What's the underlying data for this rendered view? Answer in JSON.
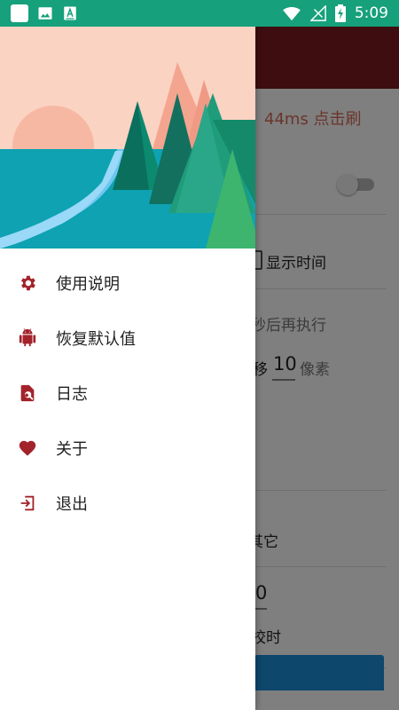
{
  "status_bar": {
    "time": "5:09",
    "battery_level": "charging"
  },
  "background_screen": {
    "speed_text": "44ms  点击刷",
    "show_time_label": "显示时间",
    "delay_label": "秒后再执行",
    "offset_prefix": "移",
    "offset_value": "10",
    "offset_unit": "像素",
    "other_label": "其它",
    "field_value": "0",
    "calibrate_label": "校时"
  },
  "drawer": {
    "menu": [
      {
        "label": "使用说明",
        "icon": "gear-icon"
      },
      {
        "label": "恢复默认值",
        "icon": "android-icon"
      },
      {
        "label": "日志",
        "icon": "log-search-icon"
      },
      {
        "label": "关于",
        "icon": "heart-icon"
      },
      {
        "label": "退出",
        "icon": "exit-icon"
      }
    ]
  },
  "colors": {
    "status_bar": "#16a07b",
    "accent": "#a3232b",
    "toolbar": "#7a1b1e"
  }
}
